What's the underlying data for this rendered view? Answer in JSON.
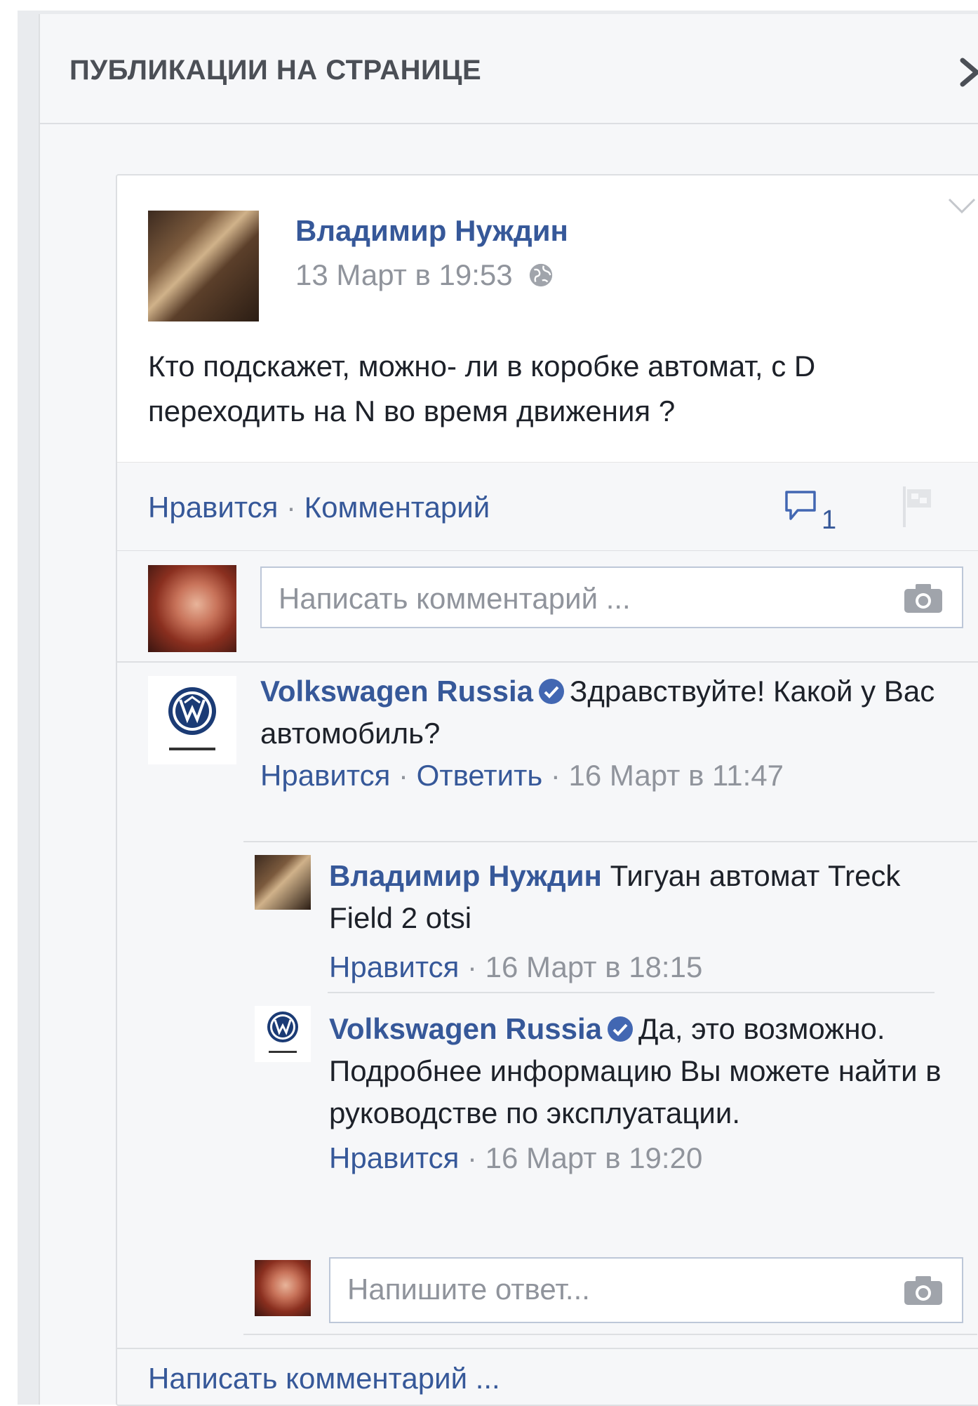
{
  "panel": {
    "title": "ПУБЛИКАЦИИ НА СТРАНИЦЕ"
  },
  "post": {
    "author": "Владимир Нуждин",
    "time": "13 Март в 19:53",
    "text": "Кто подскажет, можно- ли в коробке автомат, с D переходить на N во время движения ?",
    "actions": {
      "like": "Нравится",
      "separator": " · ",
      "comment": "Комментарий"
    },
    "comment_count": "1"
  },
  "composer": {
    "placeholder": "Написать комментарий ..."
  },
  "comments": [
    {
      "author": "Volkswagen Russia",
      "text": "Здравствуйте! Какой у Вас автомобиль?",
      "like": "Нравится",
      "reply": "Ответить",
      "time": "16 Март в 11:47"
    }
  ],
  "replies": [
    {
      "author": "Владимир Нуждин",
      "text": "Тигуан автомат Treck Field 2 otsi",
      "like": "Нравится",
      "time": "16 Март в 18:15"
    },
    {
      "author": "Volkswagen Russia",
      "text": "Да, это возможно. Подробнее информацию Вы можете найти в руководстве по эксплуатации.",
      "like": "Нравится",
      "time": "16 Март в 19:20"
    }
  ],
  "reply_composer": {
    "placeholder": "Напишите ответ..."
  },
  "footer": {
    "write_comment": "Написать комментарий ..."
  },
  "colors": {
    "link": "#365899",
    "meta": "#90949c",
    "verified": "#4267b2"
  },
  "icons": {
    "panel_arrow": "chevron-right-icon",
    "card_menu": "chevron-down-icon",
    "privacy": "globe-icon",
    "comments": "comment-bubble-icon",
    "flag": "flag-icon",
    "camera": "camera-icon",
    "verified": "verified-badge-icon"
  }
}
